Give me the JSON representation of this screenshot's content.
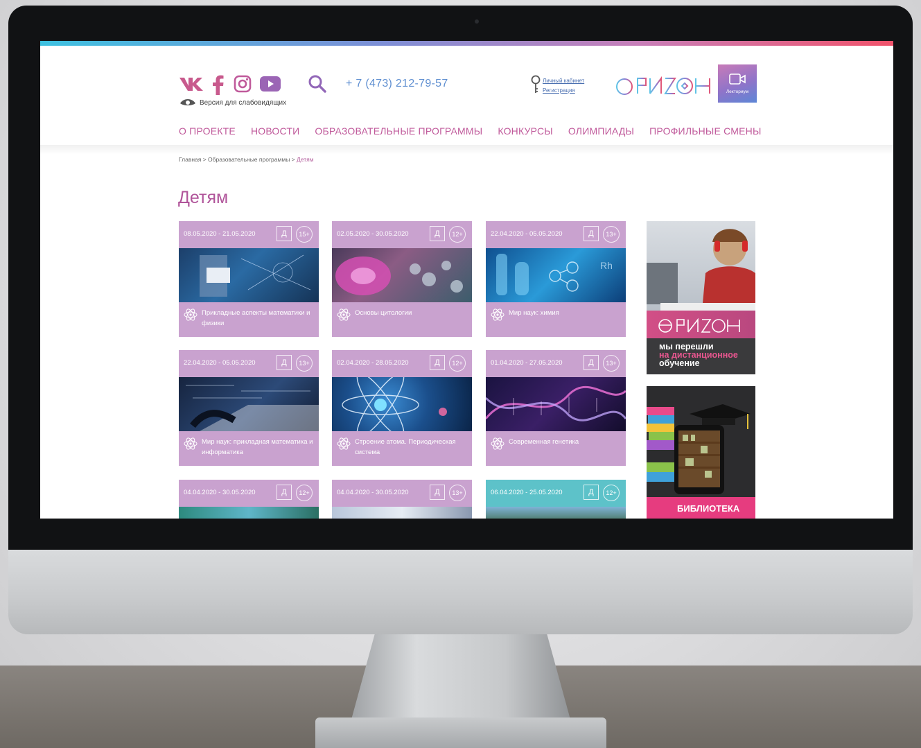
{
  "header": {
    "social": [
      "vk-icon",
      "facebook-icon",
      "instagram-icon",
      "youtube-icon"
    ],
    "phone": "+ 7 (473) 212-79-57",
    "low_vision": "Версия для слабовидящих",
    "account_link": "Личный кабинет",
    "register_link": "Регистрация",
    "lectorium_label": "Лекториум"
  },
  "nav": {
    "items": [
      "О ПРОЕКТЕ",
      "НОВОСТИ",
      "ОБРАЗОВАТЕЛЬНЫЕ ПРОГРАММЫ",
      "КОНКУРСЫ",
      "ОЛИМПИАДЫ",
      "ПРОФИЛЬНЫЕ СМЕНЫ"
    ]
  },
  "breadcrumb": {
    "home": "Главная",
    "sep": " > ",
    "section": "Образовательные программы",
    "current": "Детям"
  },
  "page": {
    "title": "Детям"
  },
  "cards": [
    {
      "date": "08.05.2020 - 21.05.2020",
      "type": "Д",
      "age": "15+",
      "title": "Прикладные аспекты математики и физики"
    },
    {
      "date": "02.05.2020 - 30.05.2020",
      "type": "Д",
      "age": "12+",
      "title": "Основы цитологии"
    },
    {
      "date": "22.04.2020 - 05.05.2020",
      "type": "Д",
      "age": "13+",
      "title": "Мир наук: химия"
    },
    {
      "date": "22.04.2020 - 05.05.2020",
      "type": "Д",
      "age": "13+",
      "title": "Мир наук: прикладная математика и информатика"
    },
    {
      "date": "02.04.2020 - 28.05.2020",
      "type": "Д",
      "age": "12+",
      "title": "Строение атома. Периодическая система"
    },
    {
      "date": "01.04.2020 - 27.05.2020",
      "type": "Д",
      "age": "13+",
      "title": "Современная генетика"
    },
    {
      "date": "04.04.2020 - 30.05.2020",
      "type": "Д",
      "age": "12+",
      "title": ""
    },
    {
      "date": "04.04.2020 - 30.05.2020",
      "type": "Д",
      "age": "13+",
      "title": ""
    },
    {
      "date": "06.04.2020 - 25.05.2020",
      "type": "Д",
      "age": "12+",
      "title": ""
    }
  ],
  "sidebar": {
    "banner1_line1": "мы перешли",
    "banner1_line2": "на дистанционное",
    "banner1_line3": "обучение",
    "banner2_label": "БИБЛИОТЕКА"
  },
  "colors": {
    "accent": "#c05a9b",
    "card": "#c9a2cf",
    "card_teal": "#5dc2c9",
    "phone": "#5f8fd1"
  }
}
